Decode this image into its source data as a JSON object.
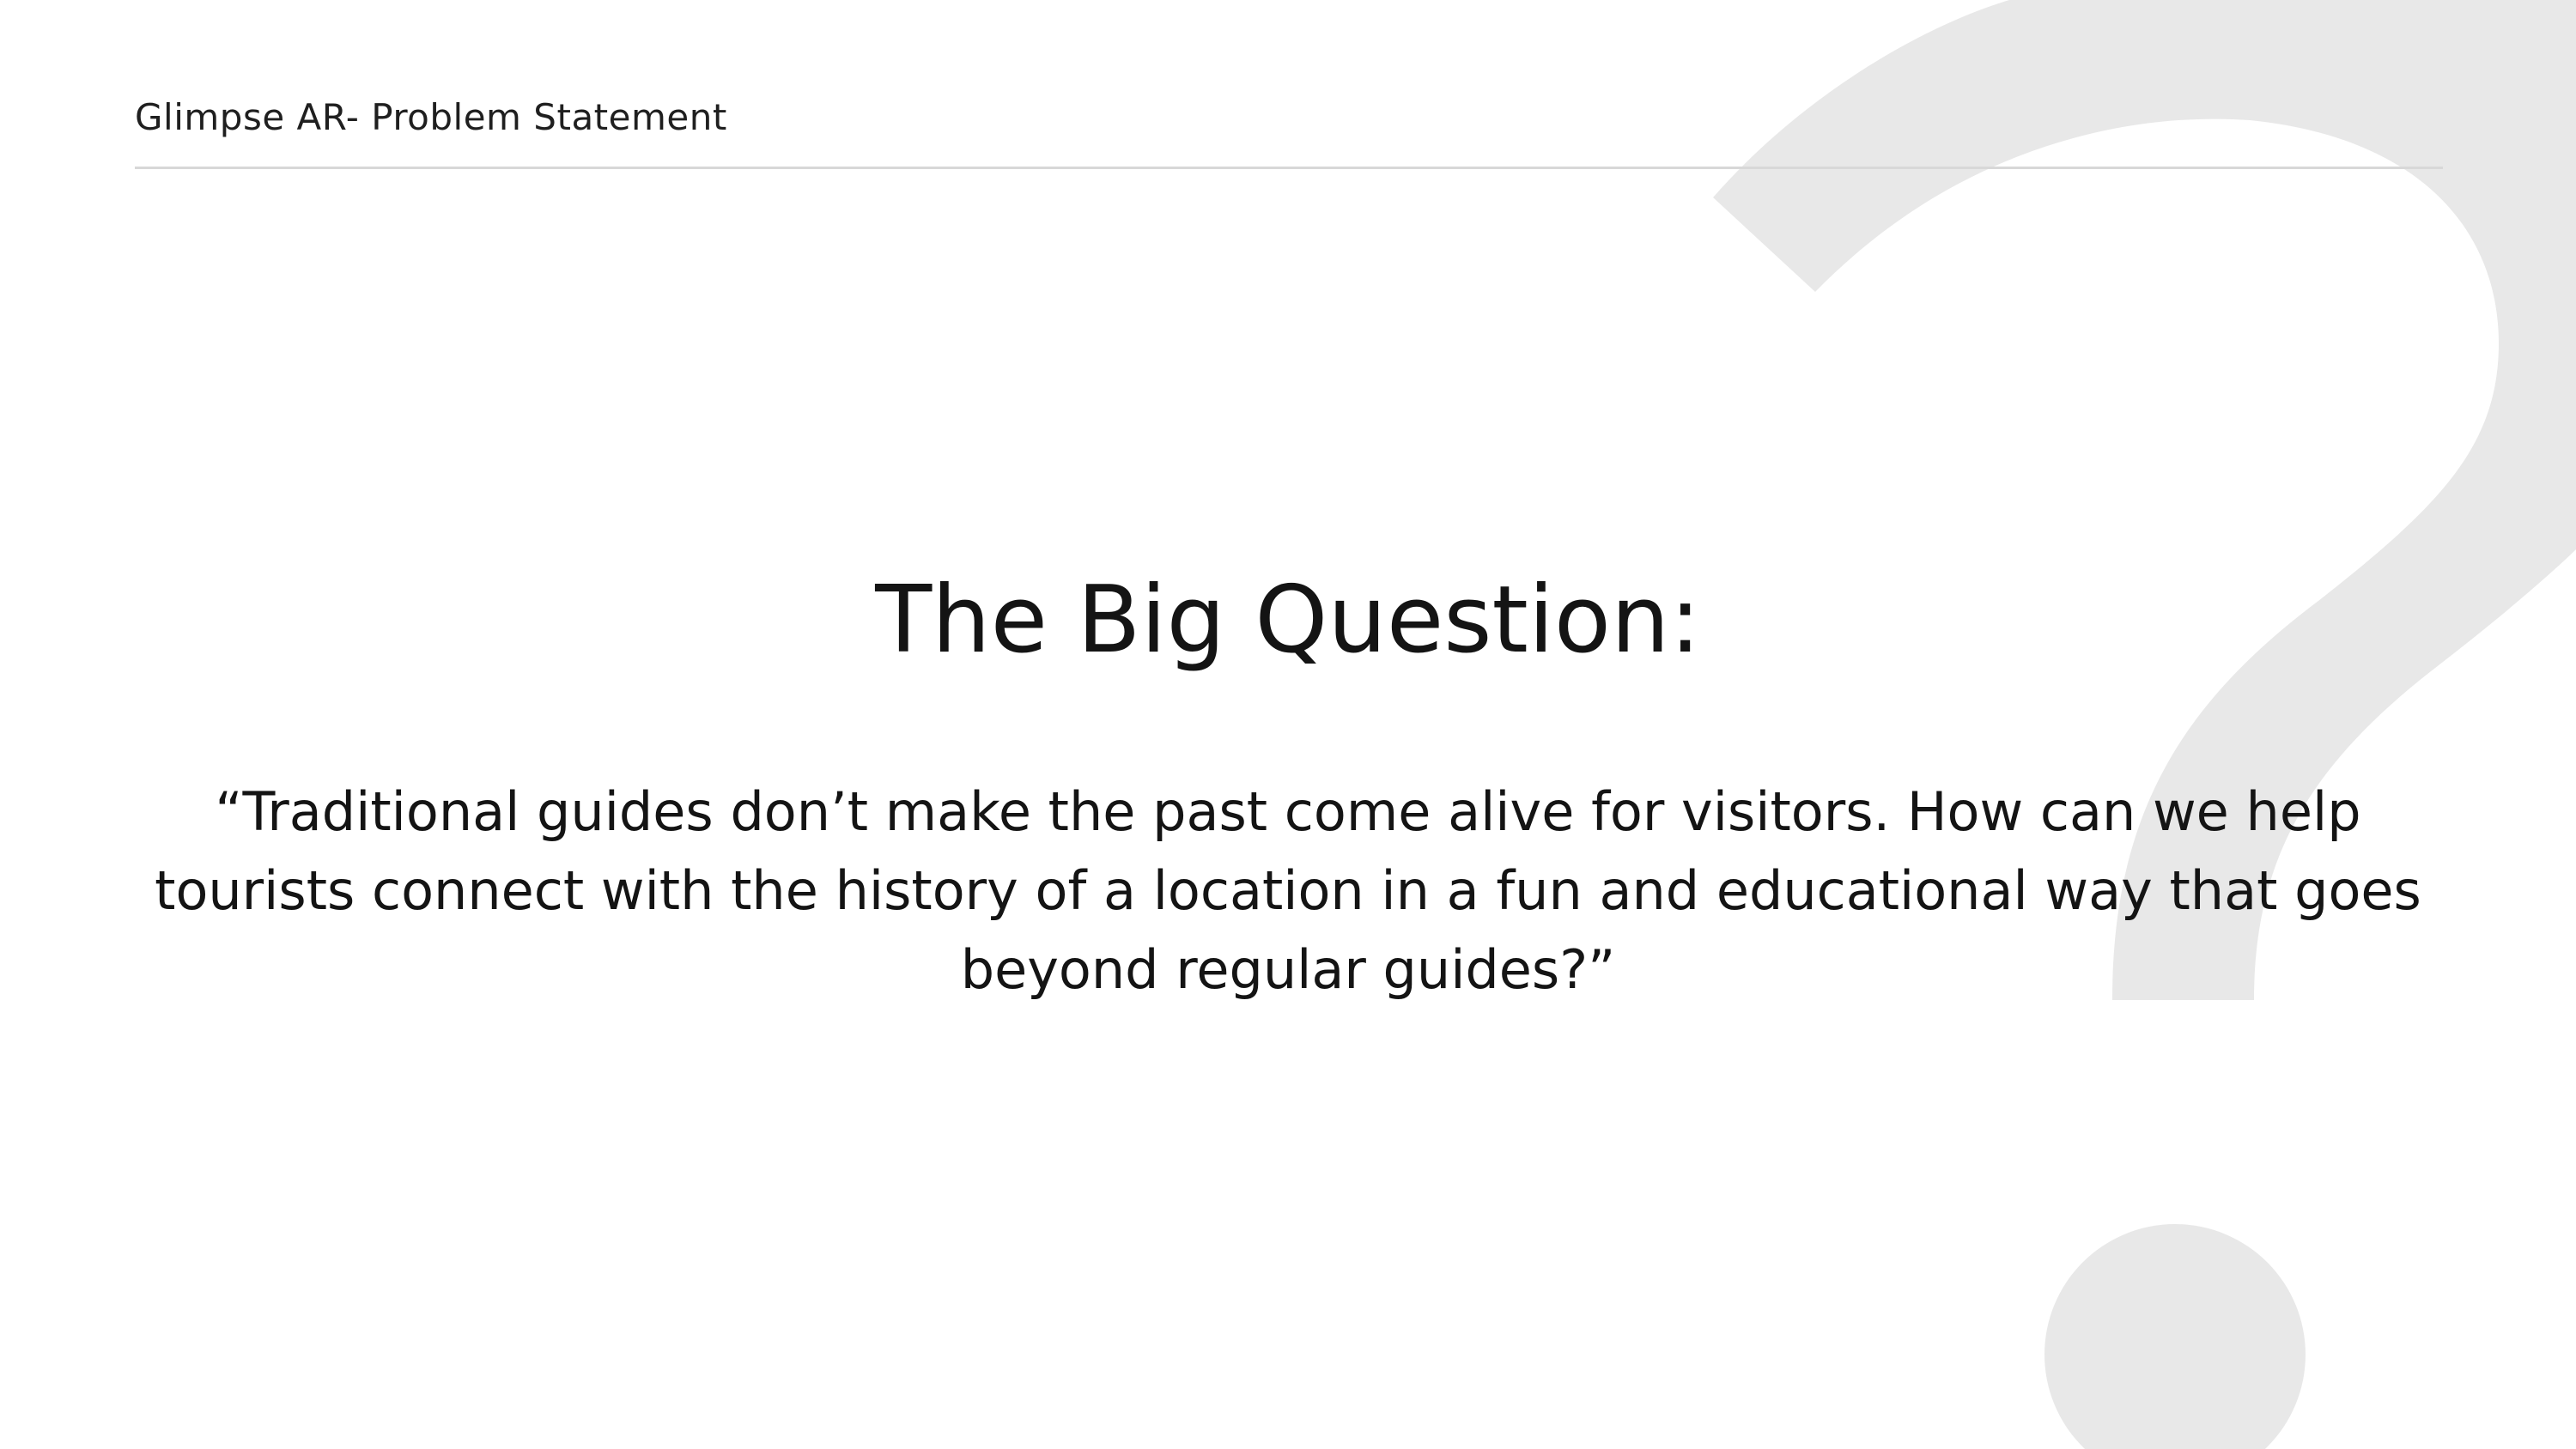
{
  "header": {
    "title": "Glimpse AR- Problem Statement"
  },
  "main": {
    "heading": "The Big Question:",
    "quote": "“Traditional guides don’t make the past come alive for visitors. How can we help tourists connect with the history of a location in a fun and educational way that goes beyond regular guides?”"
  },
  "decoration": {
    "icon": "question-mark-icon",
    "color": "#e8e8e8"
  }
}
